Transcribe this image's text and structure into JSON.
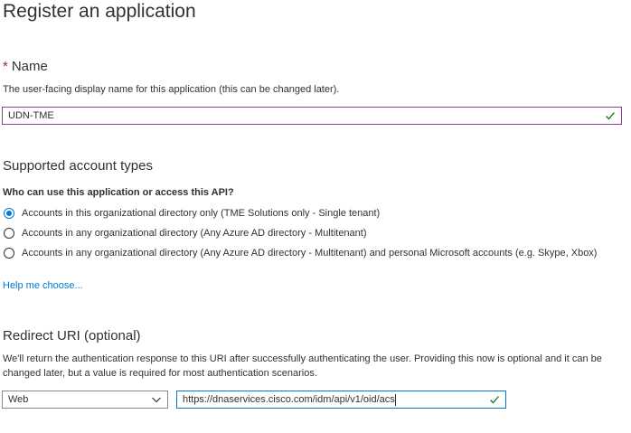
{
  "page": {
    "title": "Register an application"
  },
  "name_section": {
    "required_marker": "*",
    "heading": "Name",
    "description": "The user-facing display name for this application (this can be changed later).",
    "input_value": "UDN-TME",
    "valid_icon": "check-icon"
  },
  "account_types": {
    "heading": "Supported account types",
    "question": "Who can use this application or access this API?",
    "options": [
      {
        "label": "Accounts in this organizational directory only (TME Solutions only - Single tenant)",
        "checked": true
      },
      {
        "label": "Accounts in any organizational directory (Any Azure AD directory - Multitenant)",
        "checked": false
      },
      {
        "label": "Accounts in any organizational directory (Any Azure AD directory - Multitenant) and personal Microsoft accounts (e.g. Skype, Xbox)",
        "checked": false
      }
    ],
    "help_link": "Help me choose..."
  },
  "redirect": {
    "heading": "Redirect URI (optional)",
    "description": "We'll return the authentication response to this URI after successfully authenticating the user. Providing this now is optional and it can be changed later, but a value is required for most authentication scenarios.",
    "platform_value": "Web",
    "uri_value": "https://dnaservices.cisco.com/idm/api/v1/oid/acs",
    "valid_icon": "check-icon"
  },
  "colors": {
    "accent": "#0078d4",
    "required": "#a4262c",
    "valid_check": "#107c10",
    "active_border": "#8f3f9f"
  }
}
